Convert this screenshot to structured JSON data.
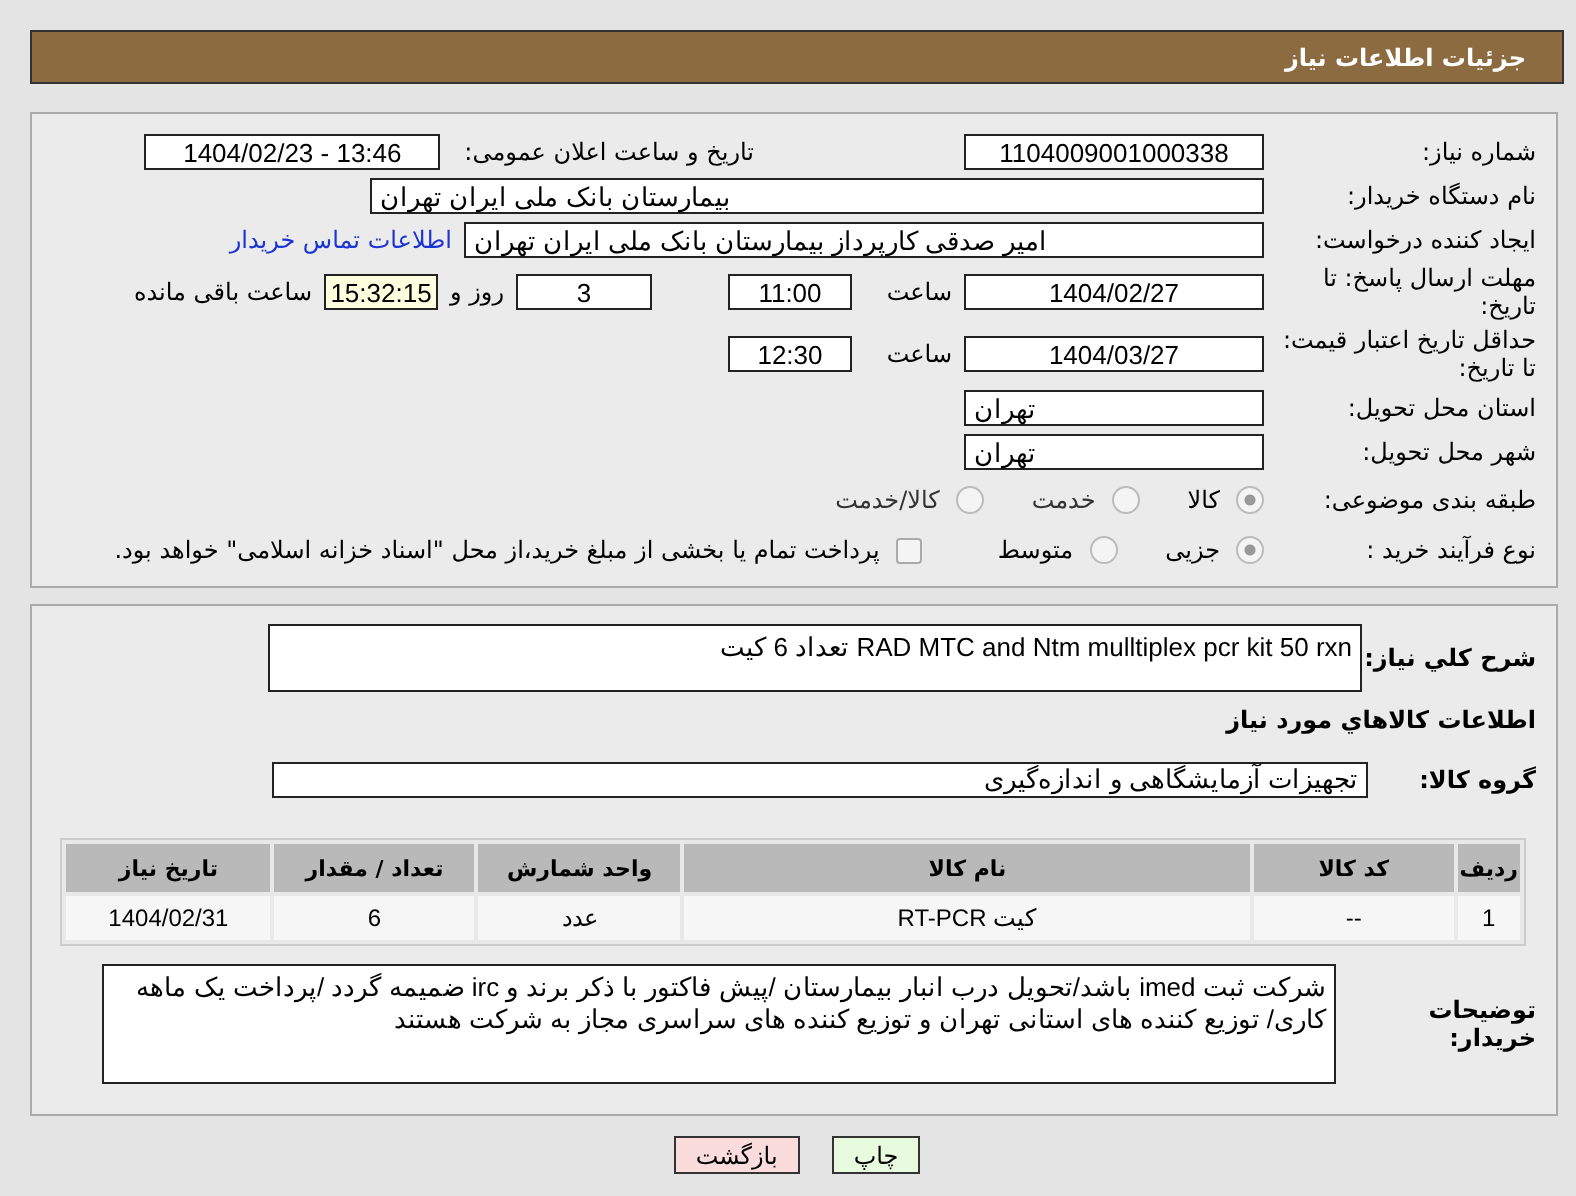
{
  "header": {
    "title": "جزئیات اطلاعات نیاز"
  },
  "need_number": {
    "label": "شماره نیاز:",
    "value": "1104009001000338"
  },
  "announce": {
    "label": "تاریخ و ساعت اعلان عمومی:",
    "value": "1404/02/23 - 13:46"
  },
  "buyer_org": {
    "label": "نام دستگاه خریدار:",
    "value": "بیمارستان بانک ملی ایران تهران"
  },
  "requester": {
    "label": "ایجاد کننده درخواست:",
    "value": "امیر صدقی کارپرداز بیمارستان بانک ملی ایران تهران",
    "link": "اطلاعات تماس خریدار"
  },
  "deadline": {
    "label": "مهلت ارسال پاسخ: تا تاریخ:",
    "date": "1404/02/27",
    "time_label": "ساعت",
    "time": "11:00",
    "days": "3",
    "days_label": "روز و",
    "remaining": "15:32:15",
    "remaining_label": "ساعت باقی مانده"
  },
  "validity": {
    "label": "حداقل تاریخ اعتبار قیمت: تا تاریخ:",
    "date": "1404/03/27",
    "time_label": "ساعت",
    "time": "12:30"
  },
  "province": {
    "label": "استان محل تحویل:",
    "value": "تهران"
  },
  "city": {
    "label": "شهر محل تحویل:",
    "value": "تهران"
  },
  "category": {
    "label": "طبقه بندی موضوعی:",
    "options": [
      {
        "label": "كالا",
        "selected": true
      },
      {
        "label": "خدمت",
        "selected": false
      },
      {
        "label": "كالا/خدمت",
        "selected": false
      }
    ]
  },
  "process": {
    "label": "نوع فرآیند خرید :",
    "options": [
      {
        "label": "جزیی",
        "selected": true
      },
      {
        "label": "متوسط",
        "selected": false
      }
    ],
    "treasury": {
      "checked": false,
      "label": "پرداخت تمام یا بخشی از مبلغ خرید،از محل \"اسناد خزانه اسلامی\" خواهد بود."
    }
  },
  "summary": {
    "label": "شرح کلي نياز:",
    "value": "RAD MTC and Ntm mulltiplex pcr kit 50 rxn تعداد 6 کیت"
  },
  "goods_heading": "اطلاعات كالاهاي مورد نياز",
  "goods_group": {
    "label": "گروه کالا:",
    "value": "تجهیزات آزمایشگاهی و اندازه‌گیری"
  },
  "table": {
    "columns": [
      "ردیف",
      "کد کالا",
      "نام کالا",
      "واحد شمارش",
      "تعداد / مقدار",
      "تاریخ نیاز"
    ],
    "rows": [
      [
        "1",
        "--",
        "کیت RT-PCR",
        "عدد",
        "6",
        "1404/02/31"
      ]
    ]
  },
  "buyer_notes": {
    "label": "توضیحات خریدار:",
    "value": "شرکت ثبت imed باشد/تحویل درب انبار بیمارستان /پیش فاکتور با ذکر برند و irc ضمیمه گردد /پرداخت یک ماهه کاری/ توزیع کننده های استانی تهران و توزیع کننده های سراسری مجاز به شرکت هستند"
  },
  "buttons": [
    {
      "label": "چاپ",
      "kind": "print"
    },
    {
      "label": "بازگشت",
      "kind": "back"
    }
  ]
}
